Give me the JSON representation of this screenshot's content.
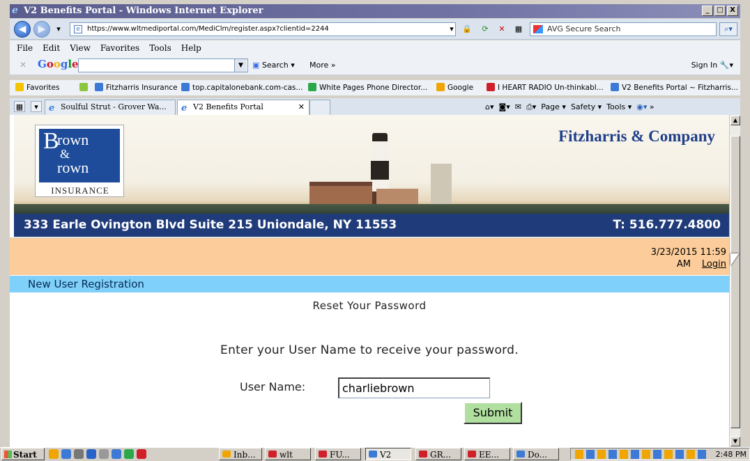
{
  "window": {
    "title": "V2 Benefits Portal - Windows Internet Explorer",
    "controls": [
      "_",
      "□",
      "X"
    ]
  },
  "address_bar": {
    "url": "https://www.wltmediportal.com/MediClm/register.aspx?clientid=2244",
    "search_placeholder": "AVG Secure Search"
  },
  "menu": [
    "File",
    "Edit",
    "View",
    "Favorites",
    "Tools",
    "Help"
  ],
  "google_toolbar": {
    "logo": "Google",
    "search_label": "Search",
    "more_label": "More",
    "sign_in": "Sign In"
  },
  "favorites": {
    "label": "Favorites",
    "items": [
      "Fitzharris Insurance",
      "top.capitalonebank.com-cas...",
      "White Pages Phone Director...",
      "Google",
      "I HEART RADIO Un-thinkabl...",
      "V2 Benefits Portal ~ Fitzharris..."
    ]
  },
  "tabs": [
    {
      "label": "Soulful Strut - Grover Wa..."
    },
    {
      "label": "V2 Benefits Portal"
    }
  ],
  "command_bar": {
    "page": "Page",
    "safety": "Safety",
    "tools": "Tools"
  },
  "banner": {
    "logo_line1": "rown",
    "logo_amp": "&",
    "logo_line2": "rown",
    "logo_b": "B",
    "logo_insurance": "INSURANCE",
    "company": "Fitzharris & Company",
    "address": "333 Earle Ovington Blvd Suite 215 Uniondale, NY 11553",
    "phone": "T: 516.777.4800"
  },
  "header": {
    "datetime_line1": "3/23/2015 11:59",
    "datetime_line2": "AM",
    "login": "Login"
  },
  "section": {
    "title": "New User Registration"
  },
  "form": {
    "heading": "Reset Your Password",
    "instruction": "Enter your User Name to receive your password.",
    "username_label": "User Name:",
    "username_value": "charliebrown",
    "submit_label": "Submit"
  },
  "taskbar": {
    "start": "Start",
    "buttons": [
      "Inb...",
      "wlt",
      "FU...",
      "V2",
      "GR...",
      "EE...",
      "Do..."
    ],
    "clock": "2:48 PM"
  }
}
